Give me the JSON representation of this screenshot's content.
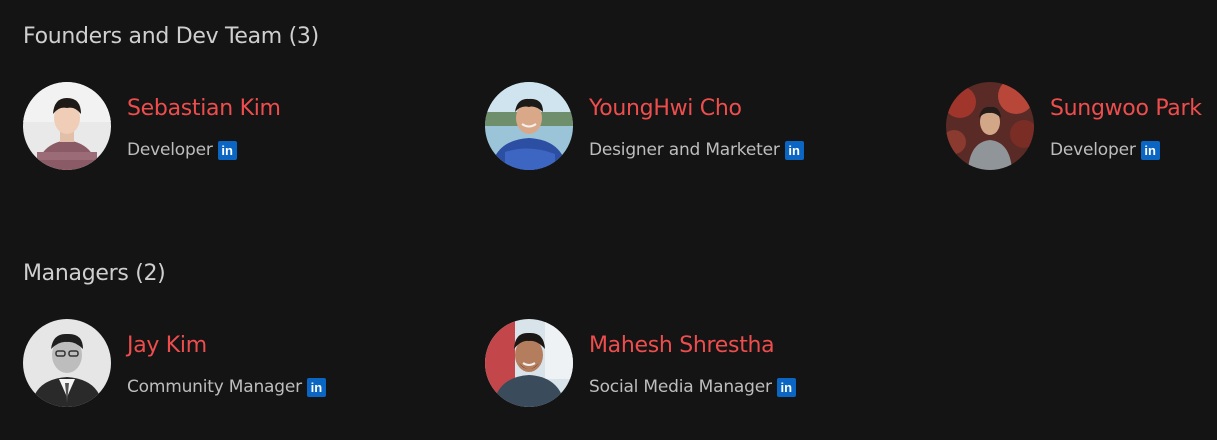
{
  "sections": [
    {
      "title": "Founders and Dev Team (3)",
      "members": [
        {
          "name": "Sebastian Kim",
          "role": "Developer"
        },
        {
          "name": "YoungHwi Cho",
          "role": "Designer and Marketer"
        },
        {
          "name": "Sungwoo Park",
          "role": "Developer"
        }
      ]
    },
    {
      "title": "Managers (2)",
      "members": [
        {
          "name": "Jay Kim",
          "role": "Community Manager"
        },
        {
          "name": "Mahesh Shrestha",
          "role": "Social Media Manager"
        }
      ]
    }
  ],
  "icons": {
    "linkedin_glyph": "in",
    "linkedin_color": "#0a66c2"
  },
  "colors": {
    "background": "#141414",
    "name_accent": "#ee4d4d",
    "section_title": "#cfcfcf",
    "role_text": "#bdbdbd"
  }
}
